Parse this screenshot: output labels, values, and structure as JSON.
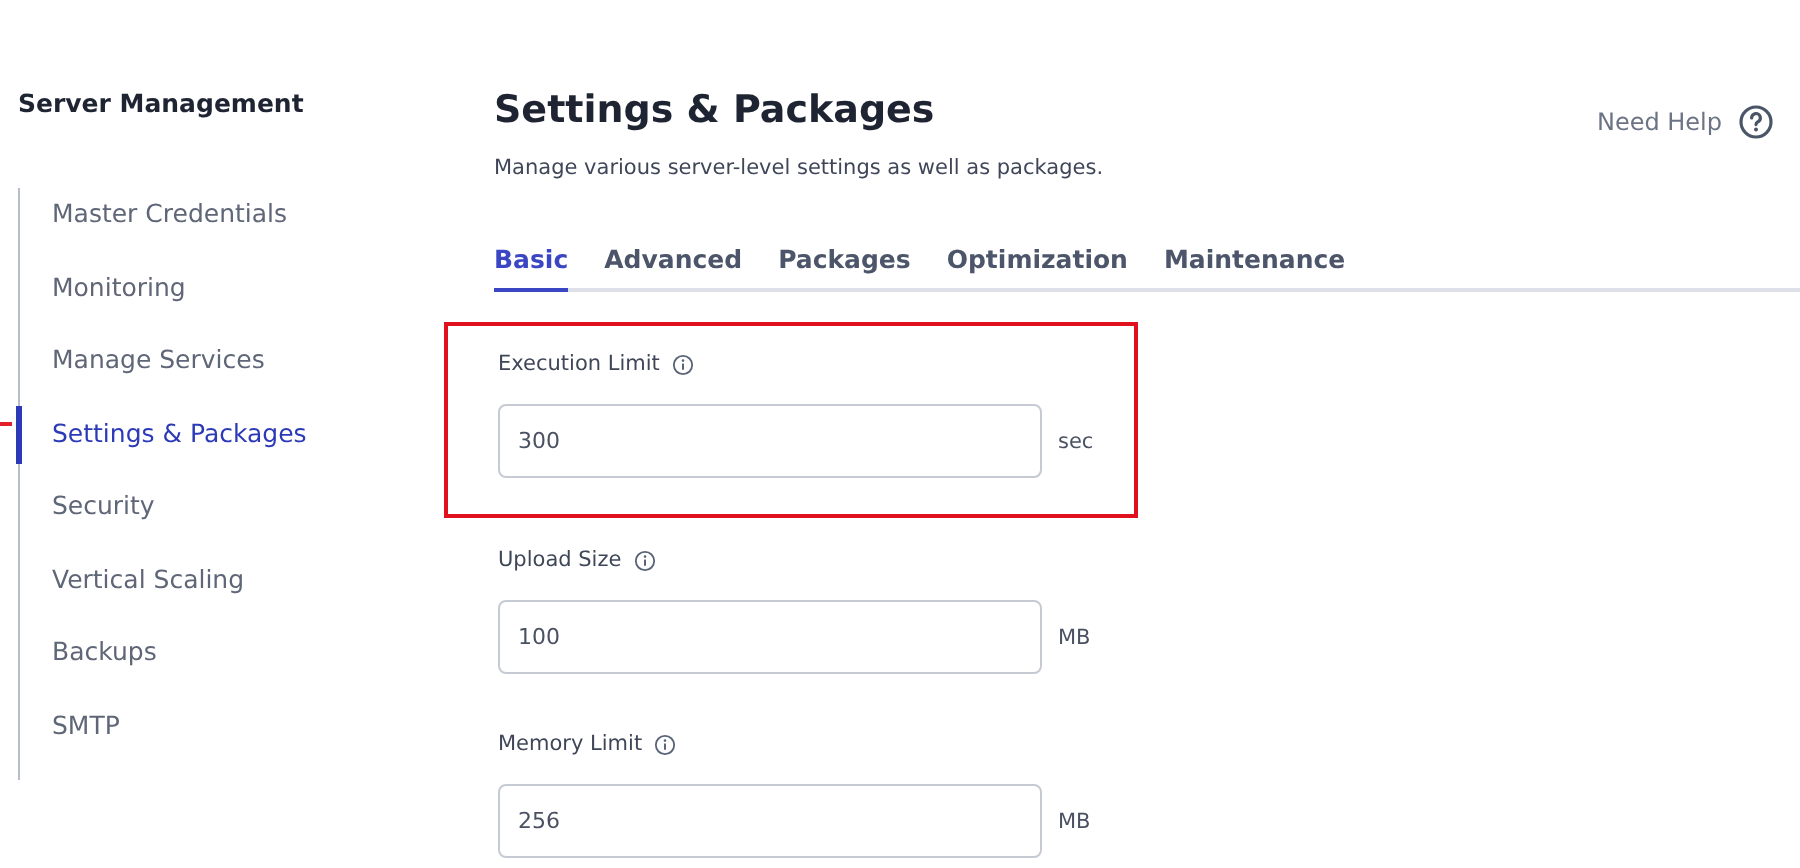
{
  "sidebar": {
    "title": "Server Management",
    "pointer": true,
    "items": [
      {
        "label": "Master Credentials",
        "selected": false
      },
      {
        "label": "Monitoring",
        "selected": false
      },
      {
        "label": "Manage Services",
        "selected": false
      },
      {
        "label": "Settings & Packages",
        "selected": true
      },
      {
        "label": "Security",
        "selected": false
      },
      {
        "label": "Vertical Scaling",
        "selected": false
      },
      {
        "label": "Backups",
        "selected": false
      },
      {
        "label": "SMTP",
        "selected": false
      }
    ]
  },
  "header": {
    "title": "Settings & Packages",
    "subtitle": "Manage various server-level settings as well as packages.",
    "help": "Need Help"
  },
  "tabs": [
    {
      "label": "Basic",
      "selected": true
    },
    {
      "label": "Advanced",
      "selected": false
    },
    {
      "label": "Packages",
      "selected": false
    },
    {
      "label": "Optimization",
      "selected": false
    },
    {
      "label": "Maintenance",
      "selected": false
    }
  ],
  "fields": [
    {
      "label": "Execution Limit",
      "value": "300",
      "unit": "sec",
      "highlighted": true
    },
    {
      "label": "Upload Size",
      "value": "100",
      "unit": "MB",
      "highlighted": false
    },
    {
      "label": "Memory Limit",
      "value": "256",
      "unit": "MB",
      "highlighted": false
    }
  ]
}
